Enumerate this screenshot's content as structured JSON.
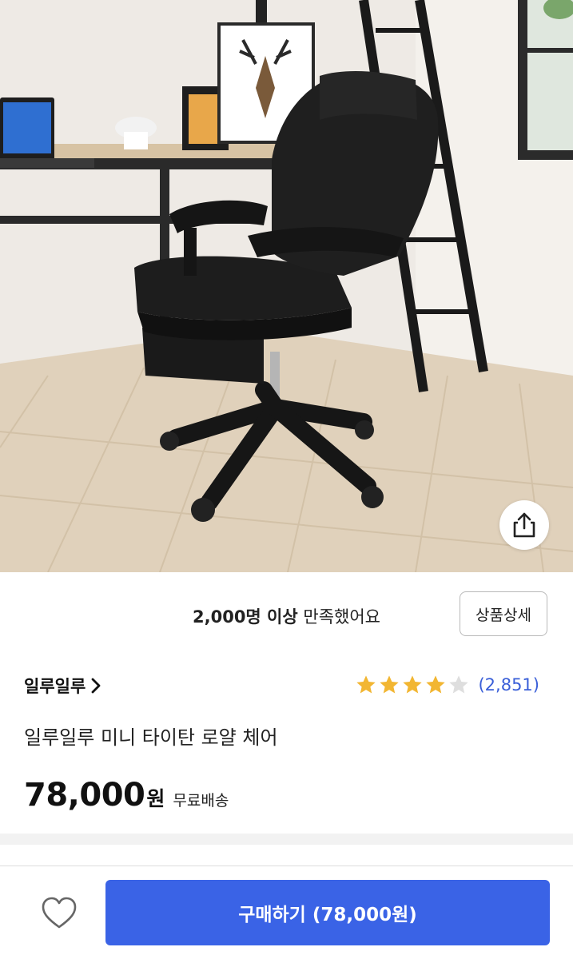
{
  "product_image": {
    "alt": "black office chair with footrest",
    "share_icon": "share-icon"
  },
  "satisfaction": {
    "count_text": "2,000명 이상",
    "suffix_text": " 만족했어요",
    "detail_button_label": "상품상세"
  },
  "seller": {
    "name": "일루일루",
    "chevron_icon": "chevron-right-icon"
  },
  "rating": {
    "stars": 4,
    "max_stars": 5,
    "review_count": "(2,851)",
    "star_color": "#f2b632",
    "star_empty_color": "#dedede"
  },
  "product": {
    "title": "일루일루 미니 타이탄 로얄 체어",
    "price": "78,000",
    "price_unit": "원",
    "shipping": "무료배송"
  },
  "bottom_bar": {
    "wishlist_icon": "heart-icon",
    "buy_label": "구매하기 (78,000원)",
    "accent": "#3a63e6"
  }
}
